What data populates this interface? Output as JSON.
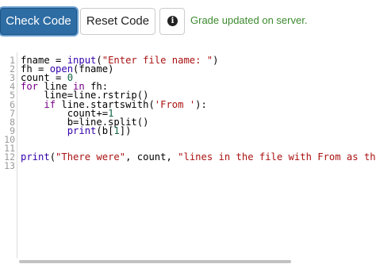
{
  "toolbar": {
    "check_label": "Check Code",
    "reset_label": "Reset Code",
    "info_icon": "info-circle-icon",
    "info_glyph": "i",
    "status_text": "Grade updated on server.",
    "status_color": "#3c8a2e",
    "primary_color": "#2e6da4"
  },
  "editor": {
    "line_numbers": [
      "1",
      "2",
      "3",
      "4",
      "5",
      "6",
      "7",
      "8",
      "9",
      "10",
      "11",
      "12",
      "13"
    ],
    "lines": [
      [
        {
          "t": "fname = "
        },
        {
          "t": "input",
          "c": "builtin"
        },
        {
          "t": "("
        },
        {
          "t": "\"Enter file name: \"",
          "c": "str"
        },
        {
          "t": ")"
        }
      ],
      [
        {
          "t": "fh = "
        },
        {
          "t": "open",
          "c": "builtin"
        },
        {
          "t": "(fname)"
        }
      ],
      [
        {
          "t": "count = "
        },
        {
          "t": "0",
          "c": "num"
        }
      ],
      [
        {
          "t": "for",
          "c": "kw"
        },
        {
          "t": " line "
        },
        {
          "t": "in",
          "c": "kw"
        },
        {
          "t": " fh:"
        }
      ],
      [
        {
          "t": "    line=line.rstrip()"
        }
      ],
      [
        {
          "t": "    "
        },
        {
          "t": "if",
          "c": "kw"
        },
        {
          "t": " line.startswith("
        },
        {
          "t": "'From '",
          "c": "str"
        },
        {
          "t": "):"
        }
      ],
      [
        {
          "t": "        count+="
        },
        {
          "t": "1",
          "c": "num"
        }
      ],
      [
        {
          "t": "        b=line.split()"
        }
      ],
      [
        {
          "t": "        "
        },
        {
          "t": "print",
          "c": "builtin"
        },
        {
          "t": "(b["
        },
        {
          "t": "1",
          "c": "num"
        },
        {
          "t": "])"
        }
      ],
      [],
      [],
      [
        {
          "t": "print",
          "c": "builtin"
        },
        {
          "t": "("
        },
        {
          "t": "\"There were\"",
          "c": "str"
        },
        {
          "t": ", count, "
        },
        {
          "t": "\"lines in the file with From as th",
          "c": "str"
        }
      ],
      []
    ]
  }
}
